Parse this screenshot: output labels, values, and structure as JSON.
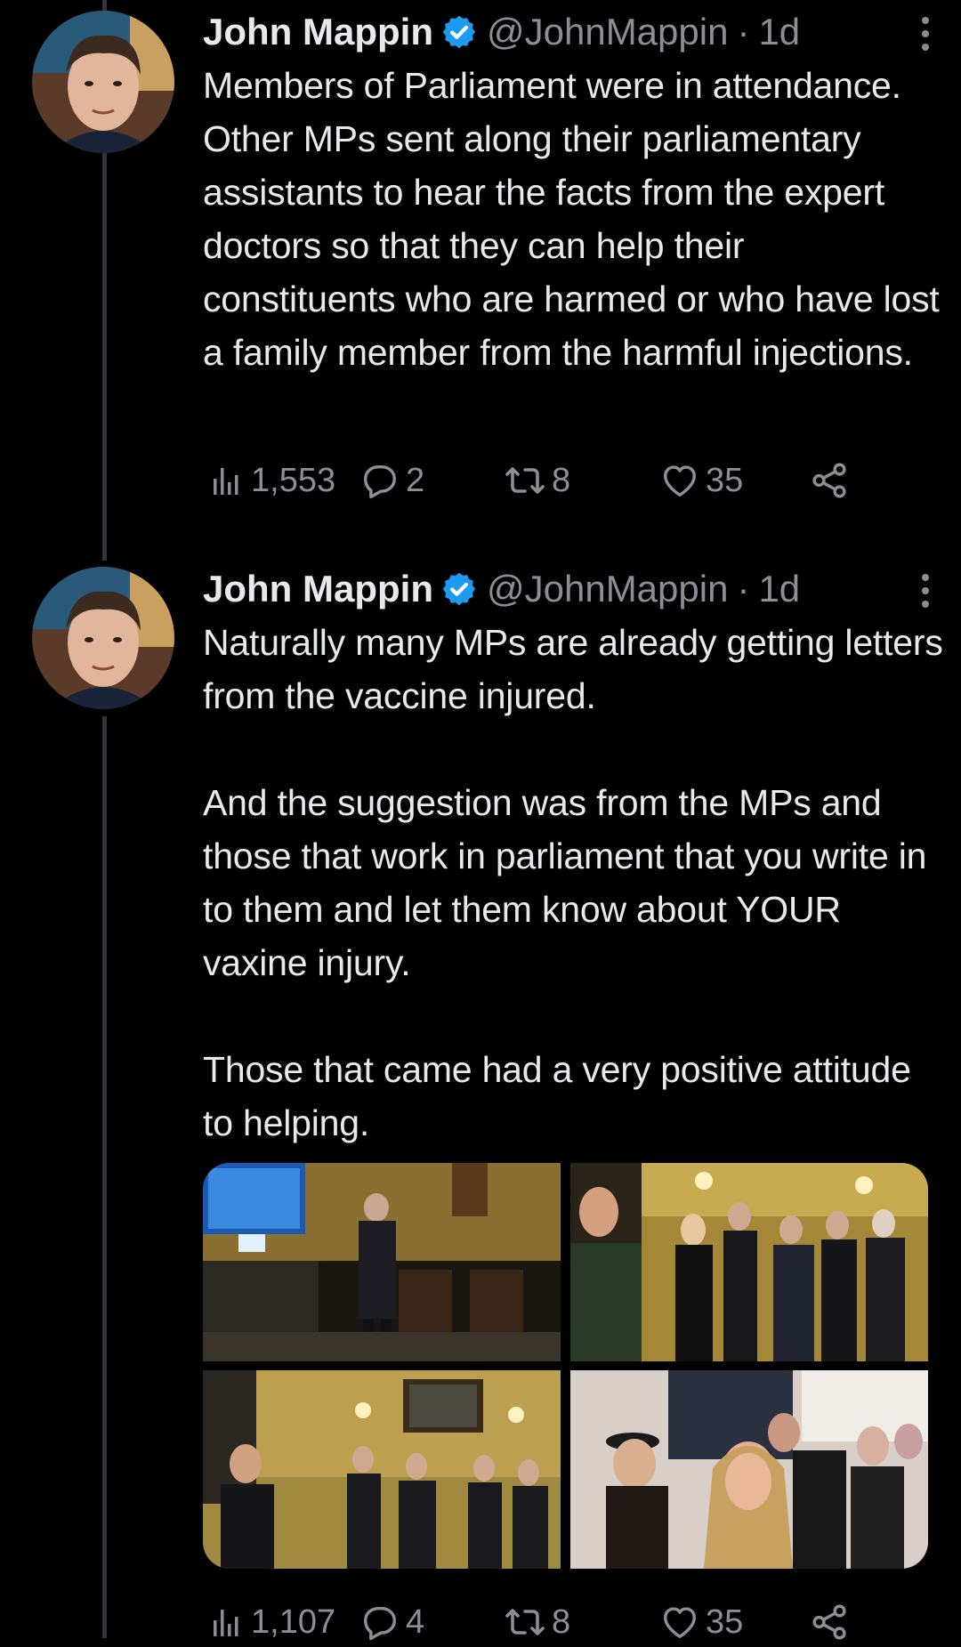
{
  "tweets": [
    {
      "name": "John Mappin",
      "handle": "@JohnMappin",
      "separator": "·",
      "time": "1d",
      "text": "Members of Parliament were in attendance.  Other MPs sent along their parliamentary assistants to hear the facts from the expert doctors so that they can help their constituents who are harmed or who have lost a family member from the harmful injections.",
      "stats": {
        "views": "1,553",
        "replies": "2",
        "retweets": "8",
        "likes": "35"
      }
    },
    {
      "name": "John Mappin",
      "handle": "@JohnMappin",
      "separator": "·",
      "time": "1d",
      "text": "Naturally many MPs are already getting letters from the vaccine injured.\n\nAnd the suggestion was from the MPs and those that work in parliament that you write in to them and let them know about YOUR vaxine injury.\n\nThose that came had a very positive attitude to helping.",
      "stats": {
        "views": "1,107",
        "replies": "4",
        "retweets": "8",
        "likes": "35"
      }
    }
  ],
  "colors": {
    "background": "#000000",
    "text": "#e7e9ea",
    "muted": "#8b8f94",
    "verified": "#1d9bf0",
    "thread_line": "#333639"
  },
  "icons": [
    "verified-badge-icon",
    "more-options-icon",
    "views-icon",
    "reply-icon",
    "retweet-icon",
    "like-icon",
    "share-icon"
  ]
}
